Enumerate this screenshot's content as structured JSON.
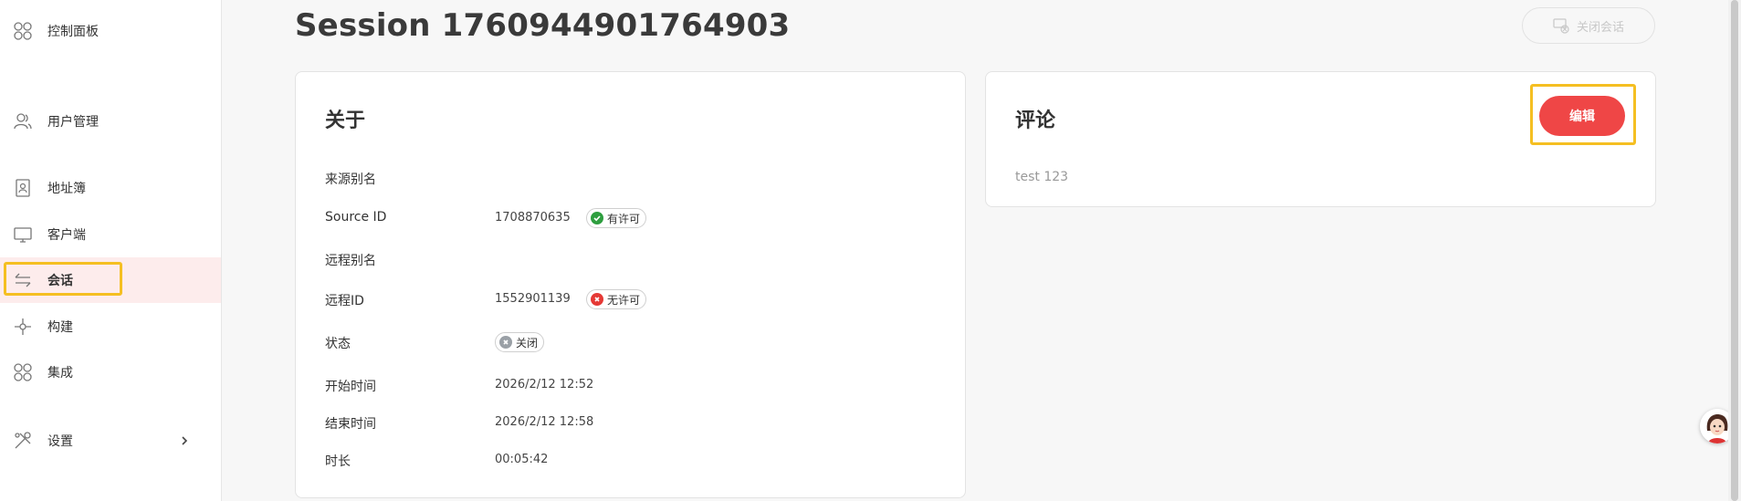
{
  "sidebar": {
    "items": [
      {
        "label": "控制面板",
        "icon": "dashboard-icon"
      },
      {
        "label": "用户管理",
        "icon": "users-icon"
      },
      {
        "label": "地址簿",
        "icon": "address-book-icon"
      },
      {
        "label": "客户端",
        "icon": "monitor-icon"
      },
      {
        "label": "会话",
        "icon": "sessions-icon",
        "active": true
      },
      {
        "label": "构建",
        "icon": "build-icon"
      },
      {
        "label": "集成",
        "icon": "integration-icon"
      },
      {
        "label": "设置",
        "icon": "settings-icon"
      }
    ]
  },
  "header": {
    "title": "Session 1760944901764903",
    "close_button_label": "关闭会话"
  },
  "about": {
    "title": "关于",
    "rows": [
      {
        "label": "来源别名",
        "value": ""
      },
      {
        "label": "Source ID",
        "value": "1708870635",
        "badge": "有许可"
      },
      {
        "label": "远程别名",
        "value": ""
      },
      {
        "label": "远程ID",
        "value": "1552901139",
        "badge": "无许可"
      },
      {
        "label": "状态",
        "badge": "关闭"
      },
      {
        "label": "开始时间",
        "value": "2026/2/12 12:52"
      },
      {
        "label": "结束时间",
        "value": "2026/2/12 12:58"
      },
      {
        "label": "时长",
        "value": "00:05:42"
      }
    ]
  },
  "comments": {
    "title": "评论",
    "edit_label": "编辑",
    "text": "test 123"
  },
  "colors": {
    "accent": "#ef4646",
    "highlight": "#f5bf22",
    "licensed": "#2e9e3f",
    "unlicensed": "#e53935",
    "closed": "#9aa0a6"
  }
}
